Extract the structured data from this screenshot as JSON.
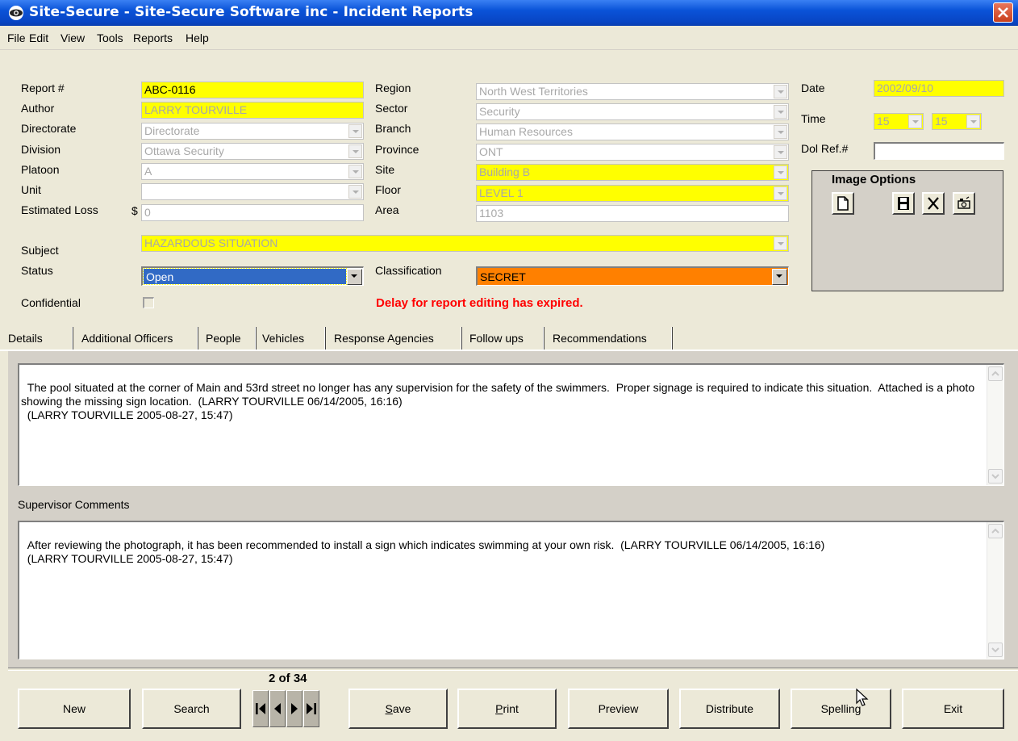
{
  "window": {
    "title": "Site-Secure - Site-Secure Software inc - Incident Reports"
  },
  "menu": [
    "File",
    "Edit",
    "View",
    "Tools",
    "Reports",
    "Help"
  ],
  "form": {
    "report_label": "Report #",
    "report_value": "ABC-0116",
    "author_label": "Author",
    "author_value": "LARRY TOURVILLE",
    "directorate_label": "Directorate",
    "directorate_value": "Directorate",
    "division_label": "Division",
    "division_value": "Ottawa Security",
    "platoon_label": "Platoon",
    "platoon_value": "A",
    "unit_label": "Unit",
    "unit_value": "",
    "loss_label": "Estimated Loss",
    "loss_currency": "$",
    "loss_value": "0",
    "region_label": "Region",
    "region_value": "North West Territories",
    "sector_label": "Sector",
    "sector_value": "Security",
    "branch_label": "Branch",
    "branch_value": "Human Resources",
    "province_label": "Province",
    "province_value": "ONT",
    "site_label": "Site",
    "site_value": "Building B",
    "floor_label": "Floor",
    "floor_value": "LEVEL 1",
    "area_label": "Area",
    "area_value": "1103",
    "date_label": "Date",
    "date_value": "2002/09/10",
    "time_label": "Time",
    "time_hour": "15",
    "time_minute": "15",
    "dolref_label": "Dol Ref.#",
    "dolref_value": "",
    "subject_label": "Subject",
    "subject_value": "HAZARDOUS SITUATION",
    "status_label": "Status",
    "status_value": "Open",
    "classification_label": "Classification",
    "classification_value": "SECRET",
    "confidential_label": "Confidential",
    "warning": "Delay for report editing has expired."
  },
  "image_options": {
    "title": "Image Options"
  },
  "tabs": [
    "Details",
    "Additional Officers",
    "People",
    "Vehicles",
    "Response Agencies",
    "Follow ups",
    "Recommendations"
  ],
  "details_text": "The pool situated at the corner of Main and 53rd street no longer has any supervision for the safety of the swimmers.  Proper signage is required to indicate this situation.  Attached is a photo showing the missing sign location.  (LARRY TOURVILLE 06/14/2005, 16:16)\n  (LARRY TOURVILLE 2005-08-27, 15:47)",
  "supervisor": {
    "label": "Supervisor Comments",
    "text": "After reviewing the photograph, it has been recommended to install a sign which indicates swimming at your own risk.  (LARRY TOURVILLE 06/14/2005, 16:16)\n  (LARRY TOURVILLE 2005-08-27, 15:47)"
  },
  "record_nav": {
    "counter": "2 of  34"
  },
  "buttons": {
    "new": "New",
    "search": "Search",
    "save_u": "S",
    "save_rest": "ave",
    "print_u": "P",
    "print_rest": "rint",
    "preview": "Preview",
    "distribute": "Distribute",
    "spelling": "Spelling",
    "exit": "Exit"
  },
  "colors": {
    "title_bar": "#0a53d8",
    "highlight_yellow": "#ffff00",
    "status_blue": "#316ac5",
    "classification_orange": "#ff8000",
    "warning_red": "#ff0000"
  }
}
